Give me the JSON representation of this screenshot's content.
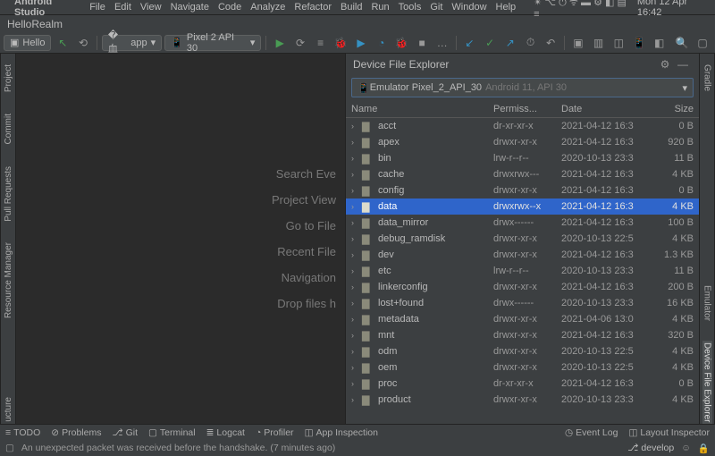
{
  "menubar": {
    "app": "Android Studio",
    "items": [
      "File",
      "Edit",
      "View",
      "Navigate",
      "Code",
      "Analyze",
      "Refactor",
      "Build",
      "Run",
      "Tools",
      "Git",
      "Window",
      "Help"
    ],
    "clock": "Mon 12 Apr  16:42"
  },
  "tab": "HelloRealm",
  "toolbar": {
    "project": "Hello",
    "run_config": "app",
    "device": "Pixel 2 API 30"
  },
  "left_tabs": [
    "Project",
    "Commit",
    "Pull Requests",
    "Resource Manager"
  ],
  "left_bottom": "ucture",
  "right_tabs": [
    "Gradle",
    "Emulator",
    "Device File Explorer"
  ],
  "editor_hints": [
    "Search Eve",
    "Project View",
    "Go to File",
    "Recent File",
    "Navigation",
    "Drop files h"
  ],
  "panel": {
    "title": "Device File Explorer",
    "device": {
      "name": "Emulator Pixel_2_API_30",
      "sub": "Android 11, API 30"
    },
    "cols": {
      "name": "Name",
      "perm": "Permiss...",
      "date": "Date",
      "size": "Size"
    },
    "rows": [
      {
        "n": "acct",
        "p": "dr-xr-xr-x",
        "d": "2021-04-12 16:3",
        "s": "0 B",
        "sel": false
      },
      {
        "n": "apex",
        "p": "drwxr-xr-x",
        "d": "2021-04-12 16:3",
        "s": "920 B",
        "sel": false
      },
      {
        "n": "bin",
        "p": "lrw-r--r--",
        "d": "2020-10-13 23:3",
        "s": "11 B",
        "sel": false
      },
      {
        "n": "cache",
        "p": "drwxrwx---",
        "d": "2021-04-12 16:3",
        "s": "4 KB",
        "sel": false
      },
      {
        "n": "config",
        "p": "drwxr-xr-x",
        "d": "2021-04-12 16:3",
        "s": "0 B",
        "sel": false
      },
      {
        "n": "data",
        "p": "drwxrwx--x",
        "d": "2021-04-12 16:3",
        "s": "4 KB",
        "sel": true
      },
      {
        "n": "data_mirror",
        "p": "drwx------",
        "d": "2021-04-12 16:3",
        "s": "100 B",
        "sel": false
      },
      {
        "n": "debug_ramdisk",
        "p": "drwxr-xr-x",
        "d": "2020-10-13 22:5",
        "s": "4 KB",
        "sel": false
      },
      {
        "n": "dev",
        "p": "drwxr-xr-x",
        "d": "2021-04-12 16:3",
        "s": "1.3 KB",
        "sel": false
      },
      {
        "n": "etc",
        "p": "lrw-r--r--",
        "d": "2020-10-13 23:3",
        "s": "11 B",
        "sel": false
      },
      {
        "n": "linkerconfig",
        "p": "drwxr-xr-x",
        "d": "2021-04-12 16:3",
        "s": "200 B",
        "sel": false
      },
      {
        "n": "lost+found",
        "p": "drwx------",
        "d": "2020-10-13 23:3",
        "s": "16 KB",
        "sel": false
      },
      {
        "n": "metadata",
        "p": "drwxr-xr-x",
        "d": "2021-04-06 13:0",
        "s": "4 KB",
        "sel": false
      },
      {
        "n": "mnt",
        "p": "drwxr-xr-x",
        "d": "2021-04-12 16:3",
        "s": "320 B",
        "sel": false
      },
      {
        "n": "odm",
        "p": "drwxr-xr-x",
        "d": "2020-10-13 22:5",
        "s": "4 KB",
        "sel": false
      },
      {
        "n": "oem",
        "p": "drwxr-xr-x",
        "d": "2020-10-13 22:5",
        "s": "4 KB",
        "sel": false
      },
      {
        "n": "proc",
        "p": "dr-xr-xr-x",
        "d": "2021-04-12 16:3",
        "s": "0 B",
        "sel": false
      },
      {
        "n": "product",
        "p": "drwxr-xr-x",
        "d": "2020-10-13 23:3",
        "s": "4 KB",
        "sel": false
      }
    ]
  },
  "bottom_tabs": [
    "TODO",
    "Problems",
    "Git",
    "Terminal",
    "Logcat",
    "Profiler",
    "App Inspection"
  ],
  "bottom_right": [
    "Event Log",
    "Layout Inspector"
  ],
  "status": {
    "msg": "An unexpected packet was received before the handshake. (7 minutes ago)",
    "branch": "develop"
  }
}
